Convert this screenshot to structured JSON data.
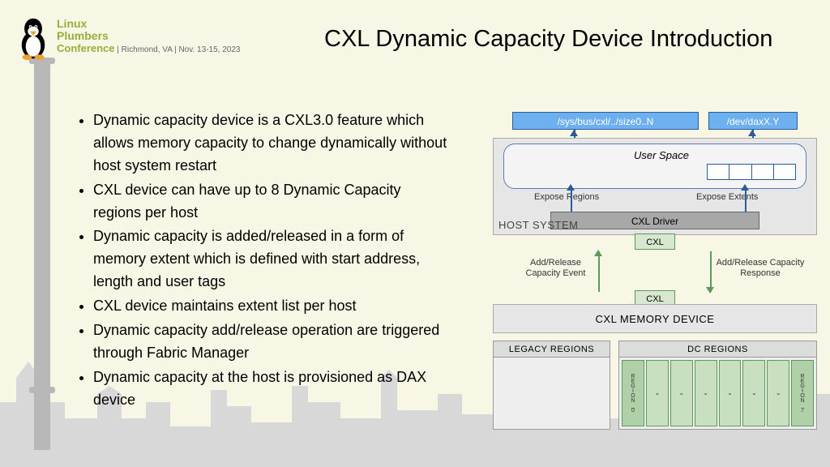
{
  "logo": {
    "line1": "Linux",
    "line2": "Plumbers",
    "line3_conf": "Conference",
    "line3_meta": " | Richmond, VA | Nov. 13-15, 2023"
  },
  "title": "CXL Dynamic Capacity Device Introduction",
  "bullets": [
    "Dynamic capacity device is a CXL3.0 feature which allows memory capacity to change dynamically without host system restart",
    "CXL device can have up to 8 Dynamic Capacity regions per host",
    "Dynamic capacity is added/released in a form of memory extent which is defined with start address, length and user tags",
    "CXL device maintains extent list per host",
    "Dynamic capacity add/release operation are triggered through Fabric Manager",
    "Dynamic capacity at the host is provisioned as DAX device"
  ],
  "diagram": {
    "sys_path": "/sys/bus/cxl/../size0..N",
    "dev_path": "/dev/daxX.Y",
    "user_space": "User Space",
    "expose_regions": "Expose Regions",
    "expose_extents": "Expose Extents",
    "cxl_driver": "CXL Driver",
    "host_system": "HOST SYSTEM",
    "cxl": "CXL",
    "add_release_event": "Add/Release Capacity Event",
    "add_release_response": "Add/Release Capacity Response",
    "cxl_memory_device": "CXL MEMORY DEVICE",
    "legacy_regions": "LEGACY REGIONS",
    "dc_regions": "DC REGIONS",
    "region_0": "REGION_0",
    "region_7": "REGION_7",
    "dash": "-"
  }
}
